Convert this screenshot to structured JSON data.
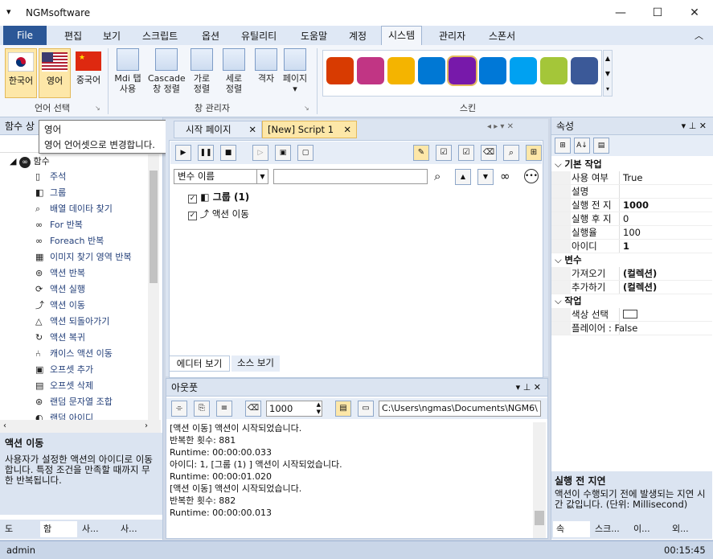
{
  "window": {
    "title": "NGMsoftware",
    "min": "—",
    "max": "☐",
    "close": "✕",
    "menu_glyph": "▾"
  },
  "menu": {
    "file": "File",
    "items": [
      "편집",
      "보기",
      "스크립트",
      "옵션",
      "유틸리티",
      "도움말",
      "계정",
      "시스템",
      "관리자",
      "스폰서"
    ],
    "active": "시스템",
    "collapse": "︿"
  },
  "ribbon": {
    "lang_group": "언어 선택",
    "lang": [
      {
        "label": "한국어"
      },
      {
        "label": "영어"
      },
      {
        "label": "중국어"
      }
    ],
    "win_group": "창 관리자",
    "win": [
      {
        "label": "Mdi 탭\n사용"
      },
      {
        "label": "Cascade\n창 정렬"
      },
      {
        "label": "가로\n정렬"
      },
      {
        "label": "세로\n정렬"
      },
      {
        "label": "격자"
      },
      {
        "label": "페이지\n▾"
      }
    ],
    "skin_group": "스킨",
    "skins": [
      "office-icon",
      "instagram-icon",
      "photos-icon",
      "bing-icon",
      "onenote-icon",
      "windows-icon",
      "cortana-icon",
      "android-icon",
      "facebook-icon"
    ]
  },
  "tooltip": {
    "title": "영어",
    "body": "영어 언어셋으로 변경합니다."
  },
  "left": {
    "header": "함수 상",
    "root": "함수",
    "items": [
      "주석",
      "그룹",
      "배열 데이타 찾기",
      "For 반복",
      "Foreach 반복",
      "이미지 찾기 영역 반복",
      "액션 반복",
      "액션 실행",
      "액션 이동",
      "액션 되돌아가기",
      "액션 복귀",
      "캐이스 액션 이동",
      "오프셋 추가",
      "오프셋 삭제",
      "랜덤 문자열 조합",
      "랜덤 아이디"
    ],
    "desc_title": "액션 이동",
    "desc_body": "사용자가 설정한 액션의 아이디로 이동합니다. 특정 조건을 만족할 때까지 무한 반복됩니다.",
    "bottom_tabs": [
      "도",
      "함",
      "사...",
      "사..."
    ]
  },
  "doc": {
    "tabs": [
      "시작 페이지",
      "[New] Script 1"
    ],
    "var_select": "변수 이름",
    "tree": [
      {
        "label": "그룹 (1)"
      },
      {
        "label": "액션 이동"
      }
    ],
    "bottom_tabs": [
      "에디터 보기",
      "소스 보기"
    ]
  },
  "output": {
    "header": "아웃풋",
    "count": "1000",
    "path": "C:\\Users\\ngmas\\Documents\\NGM6\\",
    "lines": [
      "[액션 이동] 액션이 시작되었습니다.",
      "반복한 횟수: 881",
      "Runtime: 00:00:00.033",
      "아이디: 1, [그룹 (1) ] 액션이 시작되었습니다.",
      "Runtime: 00:00:01.020",
      "[액션 이동] 액션이 시작되었습니다.",
      "반복한 횟수: 882",
      "Runtime: 00:00:00.013"
    ]
  },
  "props": {
    "header": "속성",
    "sections": [
      {
        "name": "기본 작업",
        "rows": [
          [
            "사용 여부",
            "True"
          ],
          [
            "설명",
            ""
          ],
          [
            "실행 전 지",
            "1000"
          ],
          [
            "실행 후 지",
            "0"
          ],
          [
            "실행율",
            "100"
          ],
          [
            "아이디",
            "1"
          ]
        ]
      },
      {
        "name": "변수",
        "rows": [
          [
            "가져오기",
            "(컬렉션)"
          ],
          [
            "추가하기",
            "(컬렉션)"
          ]
        ]
      },
      {
        "name": "작업",
        "rows": [
          [
            "색상 선택",
            ""
          ],
          [
            "플레이어 : False",
            ""
          ]
        ]
      }
    ],
    "desc_title": "실행 전 지연",
    "desc_body": "액션이 수행되기 전에 발생되는 지연 시간 값입니다. (단위: Millisecond)",
    "bottom_tabs": [
      "속",
      "스크...",
      "이...",
      "외..."
    ]
  },
  "status": {
    "user": "admin",
    "time": "00:15:45"
  }
}
